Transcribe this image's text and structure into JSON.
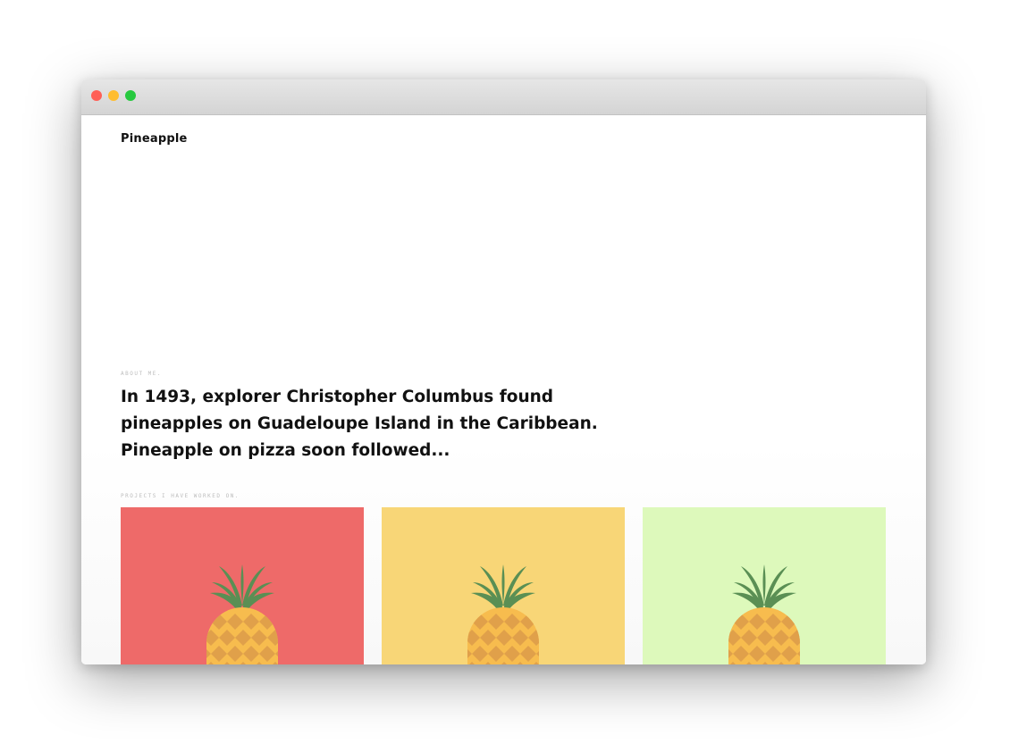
{
  "site": {
    "brand": "Pineapple"
  },
  "about": {
    "label": "ABOUT ME.",
    "headline": "In 1493, explorer Christopher Columbus found pineapples on Guadeloupe Island in the Caribbean. Pineapple on pizza soon followed..."
  },
  "projects": {
    "label": "PROJECTS I HAVE WORKED ON.",
    "cards": [
      {
        "icon": "pineapple-icon",
        "background": "#ee6a69"
      },
      {
        "icon": "pineapple-icon",
        "background": "#f8d677"
      },
      {
        "icon": "pineapple-icon",
        "background": "#ddf9bb"
      }
    ]
  },
  "colors": {
    "text": "#111111",
    "label": "#bdbdbd",
    "pineapple_body": "#f7bc4e",
    "pineapple_diamond": "#e0a04a",
    "pineapple_leaves": "#5a8f54"
  }
}
